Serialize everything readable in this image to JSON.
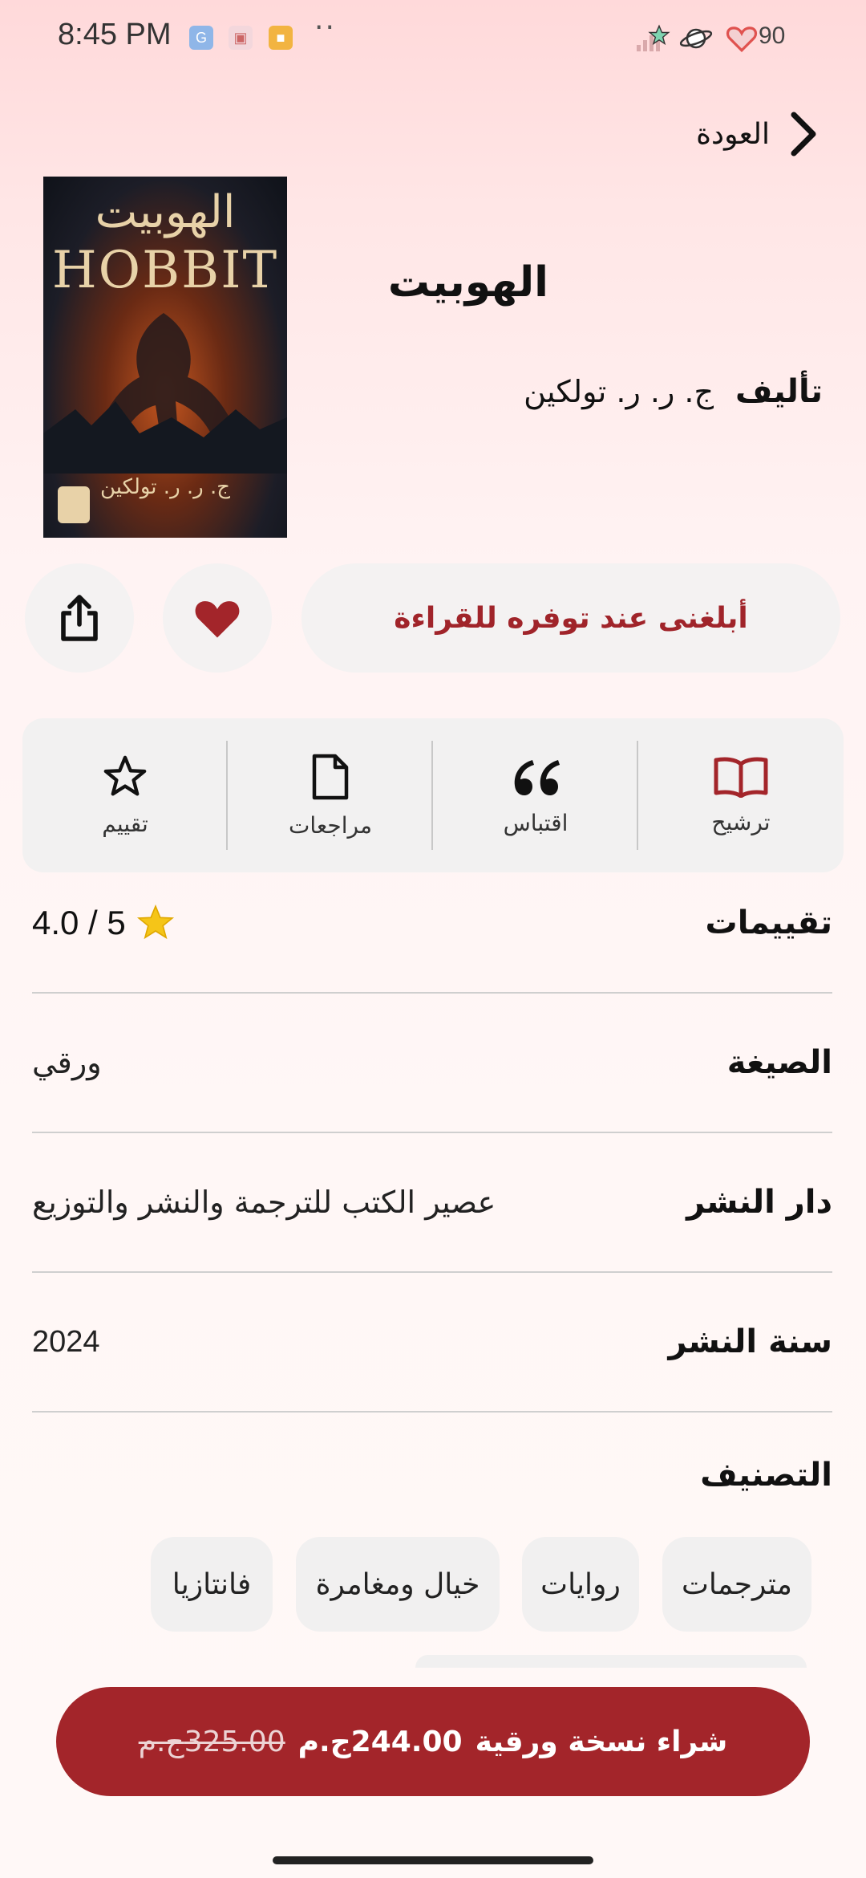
{
  "status_bar": {
    "time": "8:45 PM",
    "battery": "90",
    "icons": [
      "app-icon-blue",
      "app-icon-pink",
      "app-icon-orange",
      "more-dots-icon",
      "signal-icon",
      "star-badge-icon",
      "planet-icon",
      "heart-battery-icon"
    ]
  },
  "header": {
    "back_label": "العودة"
  },
  "book": {
    "title": "الهوبيت",
    "author_label": "تأليف",
    "author_name": "ج. ر. ر. تولكين",
    "cover": {
      "title_ar": "الهوبيت",
      "title_en": "HOBBIT",
      "author": "ج. ر. ر. تولكين"
    }
  },
  "buttons": {
    "notify": "أبلغنى عند توفره للقراءة",
    "favorite_icon": "heart-icon",
    "share_icon": "share-icon"
  },
  "actions": [
    {
      "label": "ترشيح",
      "icon": "open-book-icon"
    },
    {
      "label": "اقتباس",
      "icon": "quote-icon"
    },
    {
      "label": "مراجعات",
      "icon": "document-icon"
    },
    {
      "label": "تقييم",
      "icon": "star-outline-icon"
    }
  ],
  "info": {
    "rating_label": "تقييمات",
    "rating_value": "4.0 / 5",
    "format_label": "الصيغة",
    "format_value": "ورقي",
    "publisher_label": "دار النشر",
    "publisher_value": "عصير الكتب للترجمة والنشر والتوزيع",
    "year_label": "سنة النشر",
    "year_value": "2024"
  },
  "classification": {
    "title": "التصنيف",
    "tags": [
      "مترجمات",
      "روايات",
      "خيال ومغامرة",
      "فانتازيا"
    ]
  },
  "purchase": {
    "label": "شراء نسخة ورقية",
    "price": "244.00ج.م",
    "old_price": "325.00ج.م"
  },
  "colors": {
    "accent": "#a3252a",
    "chip_bg": "#f1f0f0",
    "star": "#f5c518"
  }
}
